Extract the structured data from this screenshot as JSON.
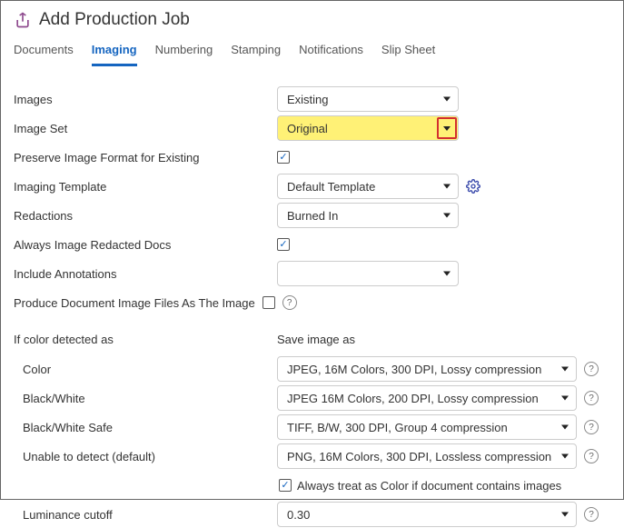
{
  "header": {
    "title": "Add Production Job"
  },
  "tabs": {
    "documents": "Documents",
    "imaging": "Imaging",
    "numbering": "Numbering",
    "stamping": "Stamping",
    "notifications": "Notifications",
    "slip_sheet": "Slip Sheet"
  },
  "form": {
    "images_label": "Images",
    "images_value": "Existing",
    "image_set_label": "Image Set",
    "image_set_value": "Original",
    "preserve_format_label": "Preserve Image Format for Existing",
    "preserve_format_checked": true,
    "imaging_template_label": "Imaging Template",
    "imaging_template_value": "Default Template",
    "redactions_label": "Redactions",
    "redactions_value": "Burned In",
    "always_image_redacted_label": "Always Image Redacted Docs",
    "always_image_redacted_checked": true,
    "include_annotations_label": "Include Annotations",
    "include_annotations_value": "",
    "produce_doc_image_label": "Produce Document Image Files As The Image",
    "produce_doc_image_checked": false
  },
  "color_section": {
    "header_left": "If color detected as",
    "header_right": "Save image as",
    "rows": {
      "color_label": "Color",
      "color_value": "JPEG, 16M Colors, 300 DPI, Lossy compression",
      "bw_label": "Black/White",
      "bw_value": "JPEG 16M Colors, 200 DPI, Lossy compression",
      "bw_safe_label": "Black/White Safe",
      "bw_safe_value": "TIFF, B/W, 300 DPI, Group 4 compression",
      "unable_label": "Unable to detect (default)",
      "unable_value": "PNG, 16M Colors, 300 DPI, Lossless compression"
    },
    "always_treat_label": "Always treat as Color if document contains images",
    "always_treat_checked": true,
    "luminance_label": "Luminance cutoff",
    "luminance_value": "0.30"
  }
}
